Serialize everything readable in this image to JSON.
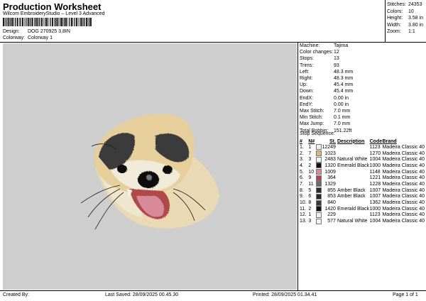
{
  "header": {
    "title": "Production Worksheet",
    "subtitle": "Wilcom EmbroideryStudio – Level 3 Advanced",
    "design_label": "Design:",
    "design_value": "DOG 270925 3,8IN",
    "colorway_label": "Colorway:",
    "colorway_value": "Colorway 1"
  },
  "stats": [
    {
      "label": "Stitches:",
      "value": "24353"
    },
    {
      "label": "Colors:",
      "value": "10"
    },
    {
      "label": "Height:",
      "value": "3.58 in"
    },
    {
      "label": "Width:",
      "value": "3.80 in"
    },
    {
      "label": "Zoom:",
      "value": "1:1"
    }
  ],
  "properties": [
    {
      "label": "Machine:",
      "value": "Tajima"
    },
    {
      "label": "Color changes:",
      "value": "12"
    },
    {
      "label": "Stops:",
      "value": "13"
    },
    {
      "label": "Trims:",
      "value": "93"
    },
    {
      "label": "Left:",
      "value": "48.3 mm"
    },
    {
      "label": "Right:",
      "value": "48.3 mm"
    },
    {
      "label": "Up:",
      "value": "45.4 mm"
    },
    {
      "label": "Down:",
      "value": "45.4 mm"
    },
    {
      "label": "EndX:",
      "value": "0.00 in"
    },
    {
      "label": "EndY:",
      "value": "0.00 in"
    },
    {
      "label": "Max Stitch:",
      "value": "7.0 mm"
    },
    {
      "label": "Min Stitch:",
      "value": "0.1 mm"
    },
    {
      "label": "Max Jump:",
      "value": "7.0 mm"
    },
    {
      "label": "Total Bobbin:",
      "value": "151.22ft"
    }
  ],
  "stop_sequence": {
    "title": "Stop Sequence:",
    "columns": [
      "#",
      "N#",
      "St.",
      "Description",
      "Code",
      "Brand"
    ],
    "rows": [
      {
        "num": "1.",
        "n": "1",
        "color": "#f3efe0",
        "st": "12249",
        "desc": "",
        "code": "1123",
        "brand": "Madeira Classic 40"
      },
      {
        "num": "2.",
        "n": "7",
        "color": "#e0b67a",
        "st": "1023",
        "desc": "",
        "code": "1270",
        "brand": "Madeira Classic 40"
      },
      {
        "num": "3.",
        "n": "3",
        "color": "#f4f2ea",
        "st": "2483",
        "desc": "Natural White",
        "code": "1004",
        "brand": "Madeira Classic 40"
      },
      {
        "num": "4.",
        "n": "2",
        "color": "#111111",
        "st": "1320",
        "desc": "Emerald Black",
        "code": "1000",
        "brand": "Madeira Classic 40"
      },
      {
        "num": "5.",
        "n": "10",
        "color": "#d98a9a",
        "st": "1009",
        "desc": "",
        "code": "1148",
        "brand": "Madeira Classic 40"
      },
      {
        "num": "6.",
        "n": "9",
        "color": "#b04a4a",
        "st": "364",
        "desc": "",
        "code": "1221",
        "brand": "Madeira Classic 40"
      },
      {
        "num": "7.",
        "n": "11",
        "color": "#6a6a6a",
        "st": "1329",
        "desc": "",
        "code": "1228",
        "brand": "Madeira Classic 40"
      },
      {
        "num": "8.",
        "n": "5",
        "color": "#2a2a2a",
        "st": "855",
        "desc": "Amber Black",
        "code": "1007",
        "brand": "Madeira Classic 40"
      },
      {
        "num": "9.",
        "n": "6",
        "color": "#2a2a2a",
        "st": "853",
        "desc": "Amber Black",
        "code": "1007",
        "brand": "Madeira Classic 40"
      },
      {
        "num": "10.",
        "n": "8",
        "color": "#3a3a3a",
        "st": "840",
        "desc": "",
        "code": "1362",
        "brand": "Madeira Classic 40"
      },
      {
        "num": "11.",
        "n": "2",
        "color": "#111111",
        "st": "1420",
        "desc": "Emerald Black",
        "code": "1000",
        "brand": "Madeira Classic 40"
      },
      {
        "num": "12.",
        "n": "1",
        "color": "#f3efe0",
        "st": "229",
        "desc": "",
        "code": "1123",
        "brand": "Madeira Classic 40"
      },
      {
        "num": "13.",
        "n": "3",
        "color": "#f4f2ea",
        "st": "577",
        "desc": "Natural White",
        "code": "1004",
        "brand": "Madeira Classic 40"
      }
    ]
  },
  "footer": {
    "created_by": "Created By:",
    "last_saved": "Last Saved: 28/09/2025 00.45.30",
    "printed": "Printed: 28/09/2025 01.34.41",
    "page": "Page 1 of 1"
  },
  "colors": {
    "design_bg": "#cecece"
  }
}
